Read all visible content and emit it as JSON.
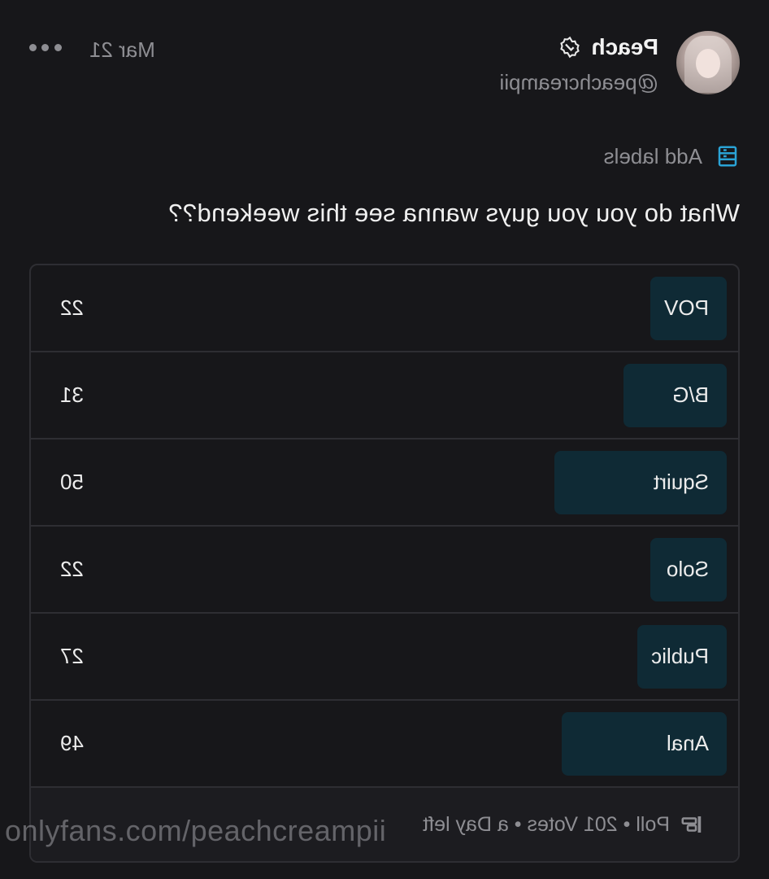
{
  "post": {
    "display_name": "Peach",
    "handle": "@peachcreampii",
    "date": "Mar 21",
    "labels_text": "Add labels",
    "text": "What do you you guys wanna see this weekend??",
    "verified_icon": "verified-badge-icon",
    "more_icon": "more-options-icon",
    "label_icon": "label-icon"
  },
  "poll": {
    "options": [
      {
        "label": "POV",
        "votes": "22",
        "share": 0.11
      },
      {
        "label": "B/G",
        "votes": "31",
        "share": 0.15
      },
      {
        "label": "Squirt",
        "votes": "50",
        "share": 0.25
      },
      {
        "label": "Solo",
        "votes": "22",
        "share": 0.11
      },
      {
        "label": "Public",
        "votes": "27",
        "share": 0.13
      },
      {
        "label": "Anal",
        "votes": "49",
        "share": 0.24
      }
    ],
    "footer_text": "Poll • 201 Votes • a Day left",
    "footer_icon": "poll-icon",
    "bar_color": "#0f2a35"
  },
  "watermark": "onlyfans.com/peachcreampii"
}
